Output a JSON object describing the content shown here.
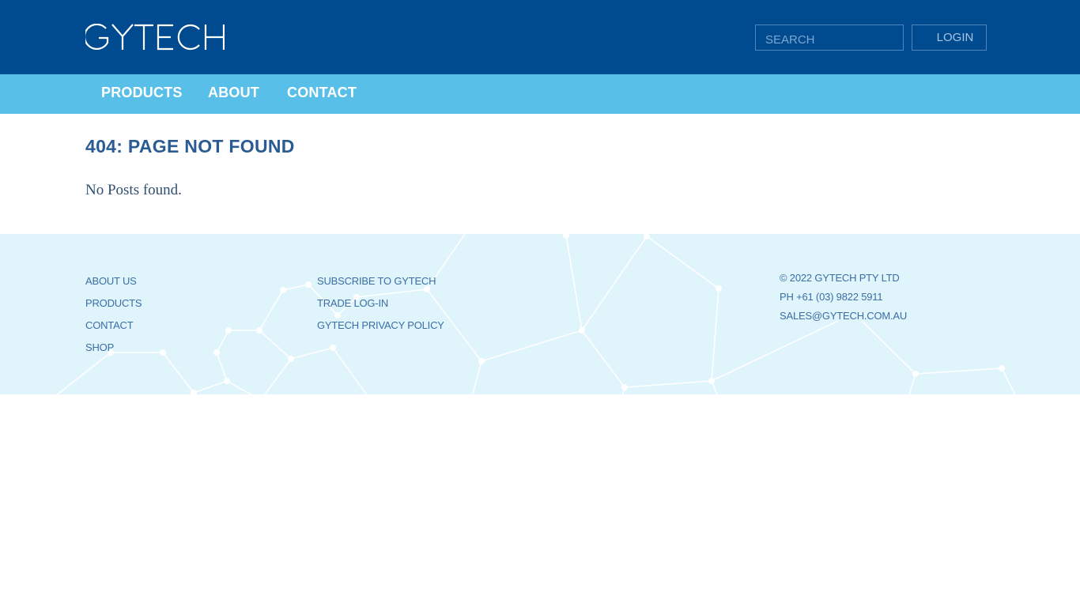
{
  "header": {
    "logo_text": "GYTECH",
    "search": {
      "placeholder": "SEARCH",
      "value": ""
    },
    "login_label": "LOGIN"
  },
  "nav": {
    "items": [
      {
        "label": "PRODUCTS"
      },
      {
        "label": "ABOUT"
      },
      {
        "label": "CONTACT"
      }
    ]
  },
  "main": {
    "title": "404: PAGE NOT FOUND",
    "message": "No Posts found."
  },
  "footer": {
    "col1": [
      {
        "label": "ABOUT US"
      },
      {
        "label": "PRODUCTS"
      },
      {
        "label": "CONTACT"
      },
      {
        "label": "SHOP"
      }
    ],
    "col2": [
      {
        "label": "SUBSCRIBE TO GYTECH"
      },
      {
        "label": "TRADE LOG-IN"
      },
      {
        "label": "GYTECH PRIVACY POLICY"
      }
    ],
    "copyright": "© 2022 GYTECH PTY LTD",
    "phone": "PH +61 (03) 9822 5911",
    "email": "SALES@GYTECH.COM.AU"
  },
  "colors": {
    "header_bg": "#004b8f",
    "nav_bg": "#57bfe8",
    "footer_bg": "#e0f4fc",
    "title": "#2a5b94",
    "link": "#3a6ea4"
  }
}
